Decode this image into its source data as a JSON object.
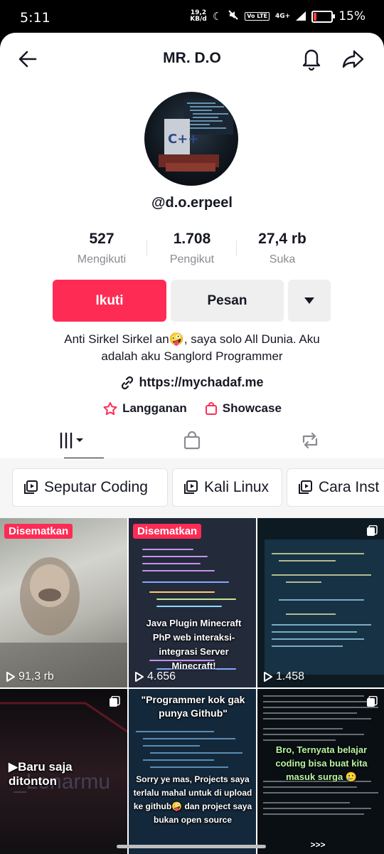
{
  "status_bar": {
    "time": "5:11",
    "speed_value": "19,2",
    "speed_unit": "KB/d",
    "network": "4G+",
    "lte": "Vo LTE",
    "battery_percent": "15%",
    "battery_level": 0.15
  },
  "header": {
    "title": "MR. D.O"
  },
  "profile": {
    "username": "@d.o.erpeel",
    "stats": [
      {
        "value": "527",
        "label": "Mengikuti"
      },
      {
        "value": "1.708",
        "label": "Pengikut"
      },
      {
        "value": "27,4 rb",
        "label": "Suka"
      }
    ],
    "follow_label": "Ikuti",
    "message_label": "Pesan",
    "bio_line1": "Anti Sirkel Sirkel an🤪, saya solo All Dunia. Aku",
    "bio_line2": "adalah aku Sanglord Programmer",
    "link": "https://mychadaf.me",
    "subscribe_label": "Langganan",
    "showcase_label": "Showcase"
  },
  "playlists": [
    "Seputar Coding",
    "Kali Linux",
    "Cara Inst"
  ],
  "videos": [
    {
      "pinned": "Disematkan",
      "views": "91,3 rb"
    },
    {
      "pinned": "Disematkan",
      "views": "4.656",
      "caption": "Java Plugin Minecraft PhP web interaksi-integrasi Server Minecraft!"
    },
    {
      "views": "1.458"
    },
    {
      "label": "Baru saja ditonton"
    },
    {
      "caption_top": "\"Programmer kok gak punya Github\"",
      "caption": "Sorry ye mas, Projects saya terlalu mahal untuk di upload ke github🤪 dan project saya bukan open source"
    },
    {
      "caption": "Bro, Ternyata belajar coding bisa buat kita masuk surga 🥲",
      "more": ">>>"
    }
  ],
  "colors": {
    "accent": "#fe2c55",
    "secondary_button": "#efeff0",
    "muted_text": "#8a8b91"
  }
}
